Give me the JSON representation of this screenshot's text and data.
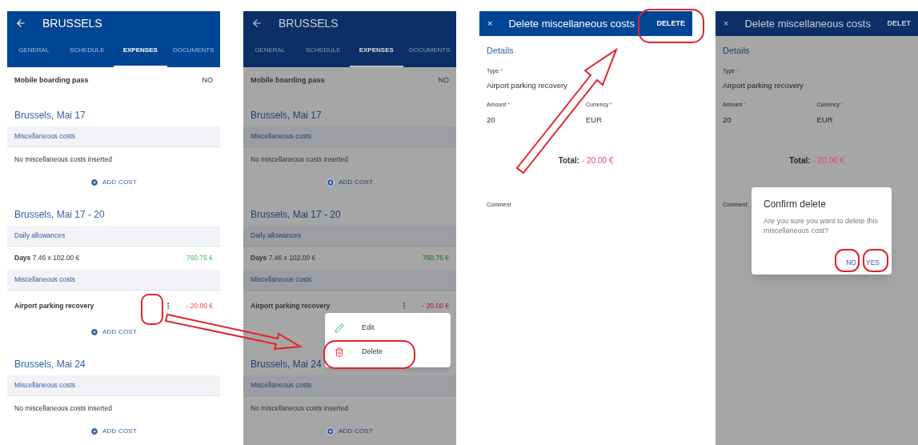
{
  "screens": [
    {
      "kind": "trip",
      "dimmed": false,
      "title": "BRUSSELS",
      "tabs": [
        {
          "label": "GENERAL",
          "selected": false
        },
        {
          "label": "SCHEDULE",
          "selected": false
        },
        {
          "label": "EXPENSES",
          "selected": true
        },
        {
          "label": "DOCUMENTS",
          "selected": false
        }
      ],
      "boarding": {
        "label": "Mobile boarding pass",
        "value": "NO"
      },
      "sections": [
        {
          "heading": "Brussels, Mai 17",
          "groups": [
            {
              "title": "Miscellaneous costs",
              "empty": "No miscellaneous costs inserted"
            }
          ],
          "add": "ADD COST"
        },
        {
          "heading": "Brussels, Mai 17 - 20",
          "groups": [
            {
              "title": "Daily allowances",
              "rows": [
                {
                  "label": "Days",
                  "detail": "7.46 x 102.00 €",
                  "amount": "760.75 €",
                  "negative": false,
                  "menu": false
                }
              ]
            },
            {
              "title": "Miscellaneous costs",
              "rows": [
                {
                  "label": "Airport parking recovery",
                  "amount": "- 20.00 €",
                  "negative": true,
                  "menu": true
                }
              ]
            }
          ],
          "add": "ADD COST"
        },
        {
          "heading": "Brussels, Mai 24",
          "groups": [
            {
              "title": "Miscellaneous costs",
              "empty": "No miscellaneous costs inserted"
            }
          ],
          "add": "ADD COST"
        }
      ]
    },
    {
      "kind": "trip",
      "dimmed": true,
      "title": "BRUSSELS",
      "tabs": [
        {
          "label": "GENERAL",
          "selected": false
        },
        {
          "label": "SCHEDULE",
          "selected": false
        },
        {
          "label": "EXPENSES",
          "selected": true
        },
        {
          "label": "DOCUMENTS",
          "selected": false
        }
      ],
      "boarding": {
        "label": "Mobile boarding pass",
        "value": "NO"
      },
      "sections": [
        {
          "heading": "Brussels, Mai 17",
          "groups": [
            {
              "title": "Miscellaneous costs",
              "empty": "No miscellaneous costs inserted"
            }
          ],
          "add": "ADD COST"
        },
        {
          "heading": "Brussels, Mai 17 - 20",
          "groups": [
            {
              "title": "Daily allowances",
              "rows": [
                {
                  "label": "Days",
                  "detail": "7.46 x 102.00 €",
                  "amount": "760.75 €",
                  "negative": false,
                  "menu": false
                }
              ]
            },
            {
              "title": "Miscellaneous costs",
              "rows": [
                {
                  "label": "Airport parking recovery",
                  "amount": "- 20.00 €",
                  "negative": true,
                  "menu": true
                }
              ]
            }
          ]
        },
        {
          "heading": "Brussels, Mai 24",
          "groups": [
            {
              "title": "Miscellaneous costs",
              "empty": "No miscellaneous costs inserted"
            }
          ],
          "add": "ADD COST"
        }
      ],
      "menu": [
        {
          "kind": "edit",
          "label": "Edit"
        },
        {
          "kind": "delete",
          "label": "Delete"
        }
      ]
    },
    {
      "kind": "form",
      "dimmed": false,
      "close": "×",
      "title": "Delete miscellaneous costs",
      "action": "DELETE",
      "section": "Details",
      "fields": [
        {
          "label": "Type",
          "required_mark": "*",
          "value": "Airport parking recovery"
        },
        {
          "label": "Amount",
          "required_mark": "*",
          "value": "20"
        },
        {
          "label": "Currency",
          "required_mark": "*",
          "value": "EUR"
        }
      ],
      "total": {
        "label": "Total:",
        "value": "- 20.00 €"
      },
      "comment": "Comment"
    },
    {
      "kind": "form",
      "dimmed": true,
      "close": "×",
      "title": "Delete miscellaneous costs",
      "action": "DELET",
      "section": "Details",
      "fields": [
        {
          "label": "Type",
          "required_mark": "*",
          "value": "Airport parking recovery"
        },
        {
          "label": "Amount",
          "required_mark": "*",
          "value": "20"
        },
        {
          "label": "Currency",
          "required_mark": "*",
          "value": "EUR"
        }
      ],
      "total": {
        "label": "Total:",
        "value": "- 20.00 €"
      },
      "comment": "Comment",
      "dialog": {
        "title": "Confirm delete",
        "message": "Are you sure you want to delete this miscellaneous cost?",
        "buttons": [
          "NO",
          "YES"
        ]
      }
    }
  ]
}
